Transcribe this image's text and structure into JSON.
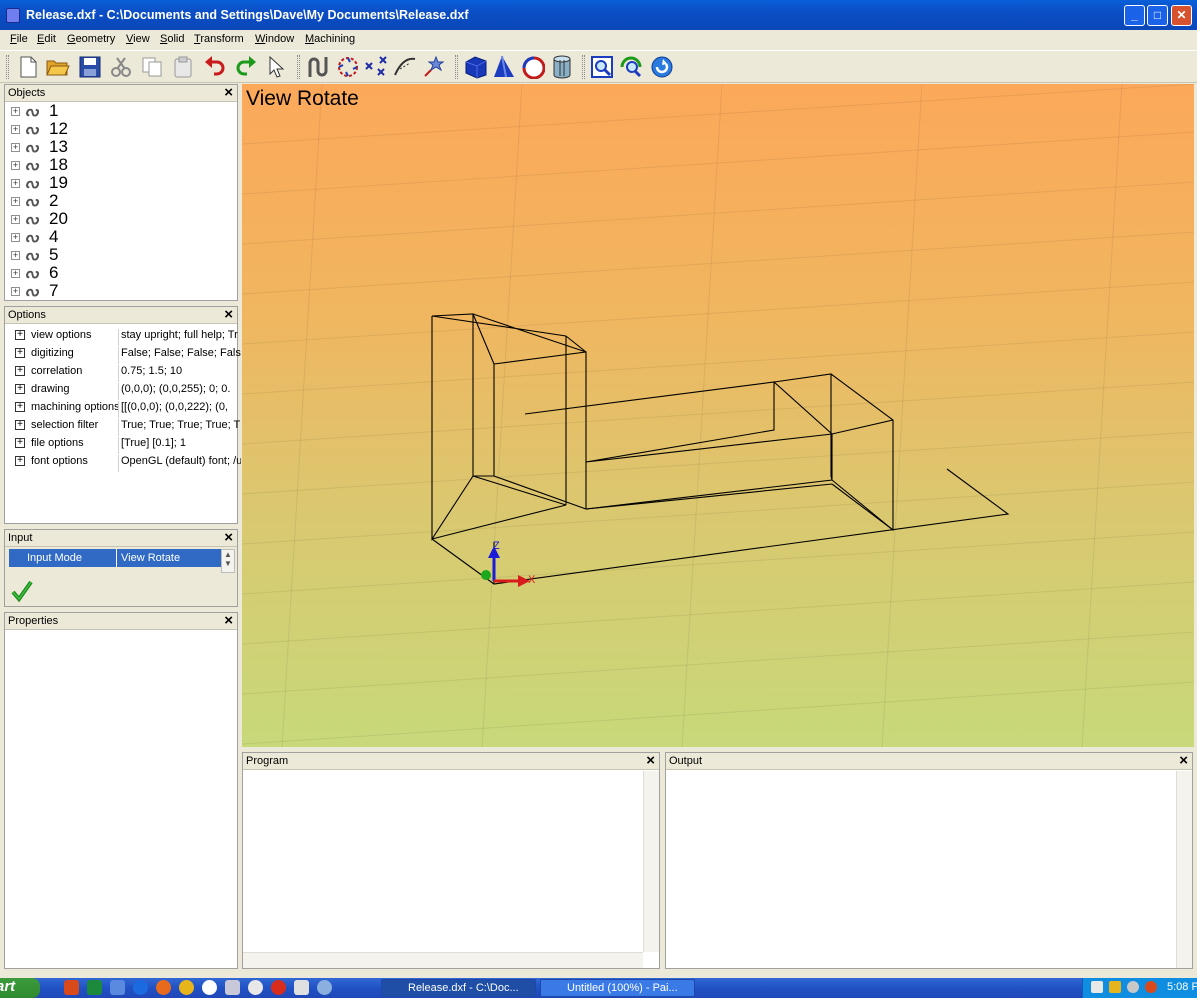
{
  "window": {
    "title": "Release.dxf - C:\\Documents and Settings\\Dave\\My Documents\\Release.dxf",
    "min": "_",
    "max": "□",
    "close": "✕"
  },
  "menu": [
    "File",
    "Edit",
    "Geometry",
    "View",
    "Solid",
    "Transform",
    "Window",
    "Machining"
  ],
  "objects": {
    "title": "Objects",
    "items": [
      "1",
      "12",
      "13",
      "18",
      "19",
      "2",
      "20",
      "4",
      "5",
      "6",
      "7"
    ]
  },
  "options": {
    "title": "Options",
    "rows": [
      {
        "name": "view options",
        "value": "stay upright; full help; Tr"
      },
      {
        "name": "digitizing",
        "value": "False; False; False; False"
      },
      {
        "name": "correlation",
        "value": "0.75; 1.5; 10"
      },
      {
        "name": "drawing",
        "value": "(0,0,0); (0,0,255); 0; 0."
      },
      {
        "name": "machining options",
        "value": "[[(0,0,0); (0,0,222); (0,"
      },
      {
        "name": "selection filter",
        "value": "True; True; True; True; T"
      },
      {
        "name": "file options",
        "value": "[True] [0.1]; 1"
      },
      {
        "name": "font options",
        "value": "OpenGL (default) font; /u"
      }
    ]
  },
  "input": {
    "title": "Input",
    "mode_label": "Input Mode",
    "mode_value": "View Rotate"
  },
  "properties": {
    "title": "Properties"
  },
  "program": {
    "title": "Program"
  },
  "output": {
    "title": "Output"
  },
  "viewport": {
    "mode_text": "View Rotate",
    "axis_x": "X",
    "axis_z": "Z"
  },
  "taskbar": {
    "start": "art",
    "tasks": [
      "Release.dxf - C:\\Doc...",
      "Untitled (100%) - Pai..."
    ],
    "clock": "5:08 P"
  },
  "colors": {
    "gradient_top": "#fca85a",
    "gradient_bottom": "#c7d97a",
    "selection": "#316ac5"
  }
}
